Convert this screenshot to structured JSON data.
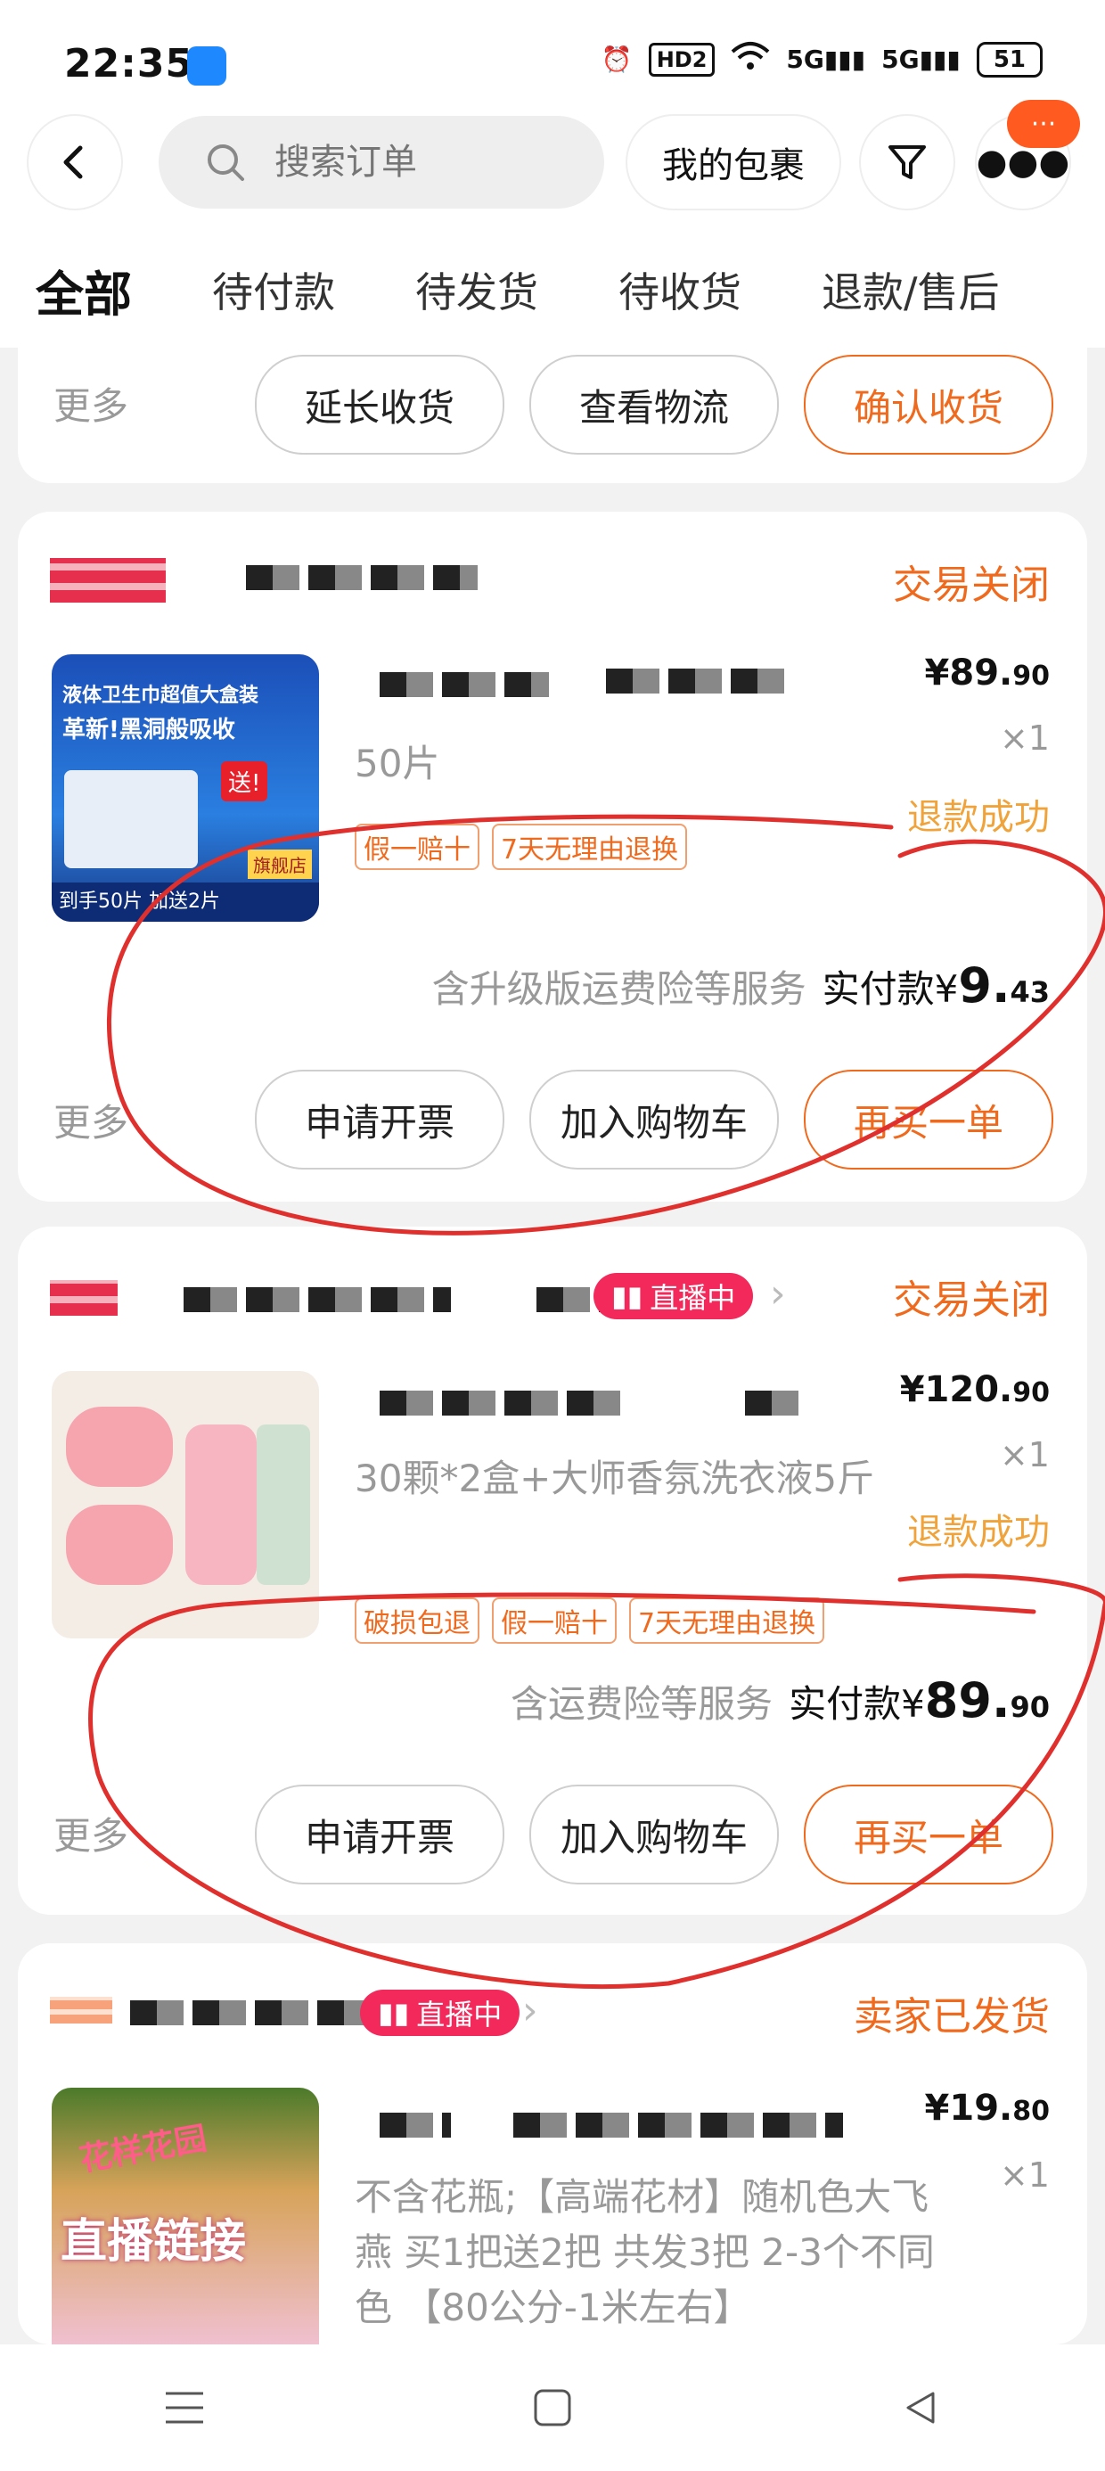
{
  "status_bar": {
    "time": "22:35",
    "hd": "HD2",
    "battery": "51"
  },
  "header": {
    "search_placeholder": "搜索订单",
    "my_packages": "我的包裹",
    "more_badge": "···"
  },
  "tabs": [
    "全部",
    "待付款",
    "待发货",
    "待收货",
    "退款/售后"
  ],
  "card0": {
    "more": "更多",
    "buttons": [
      "延长收货",
      "查看物流",
      "确认收货"
    ]
  },
  "card1": {
    "status": "交易关闭",
    "spec": "50片",
    "price_main": "¥89.",
    "price_dec": "90",
    "qty": "×1",
    "refund": "退款成功",
    "tags": [
      "假一赔十",
      "7天无理由退换"
    ],
    "service": "含升级版运费险等服务",
    "paid_label": "实付款¥",
    "paid_main": "9.",
    "paid_dec": "43",
    "more": "更多",
    "buttons": [
      "申请开票",
      "加入购物车",
      "再买一单"
    ],
    "thumb": {
      "line1": "液体卫生巾超值大盒装",
      "line2": "革新!黑洞般吸收",
      "badge": "送!",
      "footer": "到手50片 加送2片",
      "shop": "旗舰店"
    }
  },
  "card2": {
    "status": "交易关闭",
    "live": "直播中",
    "spec": "30颗*2盒+大师香氛洗衣液5斤",
    "price_main": "¥120.",
    "price_dec": "90",
    "qty": "×1",
    "refund": "退款成功",
    "tags": [
      "破损包退",
      "假一赔十",
      "7天无理由退换"
    ],
    "service": "含运费险等服务",
    "paid_label": "实付款¥",
    "paid_main": "89.",
    "paid_dec": "90",
    "more": "更多",
    "buttons": [
      "申请开票",
      "加入购物车",
      "再买一单"
    ]
  },
  "card3": {
    "status": "卖家已发货",
    "live": "直播中",
    "spec": "不含花瓶;【高端花材】随机色大飞燕 买1把送2把 共发3把 2-3个不同色 【80公分-1米左右】",
    "price_main": "¥19.",
    "price_dec": "80",
    "qty": "×1",
    "thumb": {
      "line1": "花样花园",
      "line2": "直播链接"
    }
  },
  "colors": {
    "accent": "#f06a1e",
    "live": "#f2295a",
    "refund": "#f0a33a",
    "annotation": "#e0302e"
  }
}
